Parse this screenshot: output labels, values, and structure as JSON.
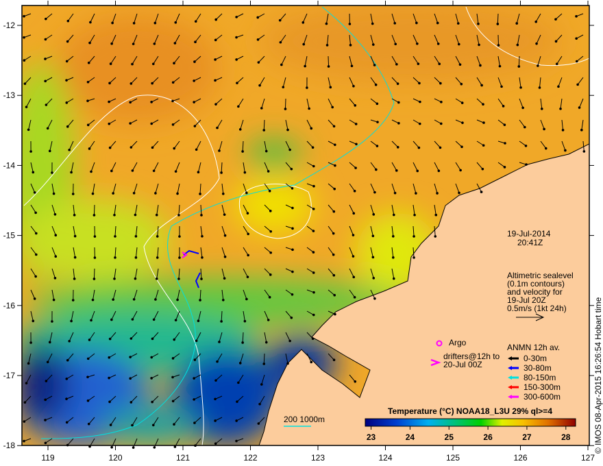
{
  "map": {
    "lon_ticks": [
      "119",
      "120",
      "121",
      "122",
      "123",
      "124",
      "125",
      "126",
      "127"
    ],
    "lat_ticks": [
      "-12",
      "-13",
      "-14",
      "-15",
      "-16",
      "-17",
      "-18"
    ],
    "colors": {
      "land": "#fccc9c",
      "frame": "#000000",
      "contour": "#ffffff",
      "isobath": "#00e0e0"
    }
  },
  "annotation": {
    "date": "19-Jul-2014",
    "time": "20:41Z",
    "altimetry": [
      "Altimetric sealevel",
      "(0.1m contours)",
      "and velocity for",
      "19-Jul 20Z",
      "0.5m/s (1kt 24h)"
    ],
    "argo_label": "Argo",
    "drifters_label": [
      "drifters@12h to",
      "20-Jul 00Z"
    ],
    "anmn_title": "ANMN 12h av.",
    "anmn_items": [
      {
        "label": "0-30m",
        "color": "#000000"
      },
      {
        "label": "30-80m",
        "color": "#0000ff"
      },
      {
        "label": "80-150m",
        "color": "#00e0e0"
      },
      {
        "label": "150-300m",
        "color": "#ff0000"
      },
      {
        "label": "300-600m",
        "color": "#ff00ff"
      }
    ],
    "isobath_label": "200  1000m",
    "credit": "© IMOS 08-Apr-2015 16:26:54 Hobart time"
  },
  "colorbar": {
    "title": "Temperature (°C) NOAA18_L3U 29% ql>=4",
    "ticks": [
      "23",
      "24",
      "25",
      "26",
      "27",
      "28"
    ],
    "range": [
      22.85,
      28.25
    ]
  }
}
